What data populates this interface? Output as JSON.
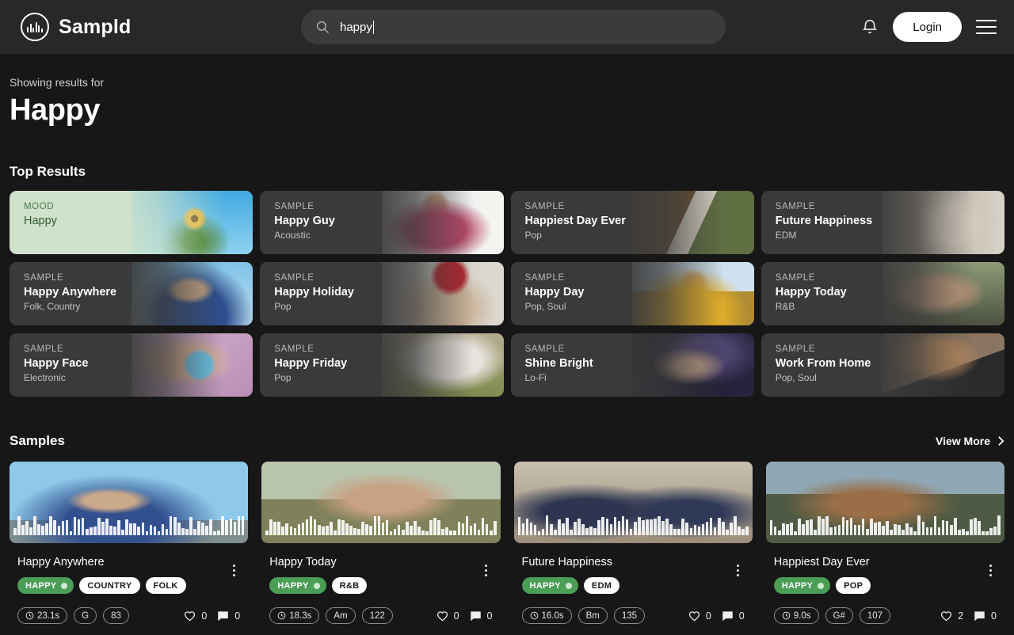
{
  "header": {
    "brand": "Sampld",
    "brand_logo_icon": "waveform-circle-icon",
    "search": {
      "icon": "search-icon",
      "value": "happy",
      "placeholder": "Search"
    },
    "notifications_icon": "bell-icon",
    "login_label": "Login",
    "menu_icon": "hamburger-menu-icon"
  },
  "results": {
    "showing_label": "Showing results for",
    "query": "Happy"
  },
  "top_results": {
    "title": "Top Results",
    "cards": [
      {
        "kind": "MOOD",
        "title": "Happy",
        "sub": "",
        "art": "ph-sunflower",
        "highlight": true
      },
      {
        "kind": "SAMPLE",
        "title": "Happy Guy",
        "sub": "Acoustic",
        "art": "ph-man-pink",
        "highlight": false
      },
      {
        "kind": "SAMPLE",
        "title": "Happiest Day Ever",
        "sub": "Pop",
        "art": "ph-road",
        "highlight": false
      },
      {
        "kind": "SAMPLE",
        "title": "Future Happiness",
        "sub": "EDM",
        "art": "ph-office",
        "highlight": false
      },
      {
        "kind": "SAMPLE",
        "title": "Happy Anywhere",
        "sub": "Folk, Country",
        "art": "ph-bluesky-girl",
        "highlight": false
      },
      {
        "kind": "SAMPLE",
        "title": "Happy Holiday",
        "sub": "Pop",
        "art": "ph-redcap",
        "highlight": false
      },
      {
        "kind": "SAMPLE",
        "title": "Happy Day",
        "sub": "Pop, Soul",
        "art": "ph-sunfield",
        "highlight": false
      },
      {
        "kind": "SAMPLE",
        "title": "Happy Today",
        "sub": "R&B",
        "art": "ph-beard",
        "highlight": false
      },
      {
        "kind": "SAMPLE",
        "title": "Happy Face",
        "sub": "Electronic",
        "art": "ph-girl-egg",
        "highlight": false
      },
      {
        "kind": "SAMPLE",
        "title": "Happy Friday",
        "sub": "Pop",
        "art": "ph-smile-rock",
        "highlight": false
      },
      {
        "kind": "SAMPLE",
        "title": "Shine Bright",
        "sub": "Lo-Fi",
        "art": "ph-galaxy",
        "highlight": false
      },
      {
        "kind": "SAMPLE",
        "title": "Work From Home",
        "sub": "Pop, Soul",
        "art": "ph-guitar",
        "highlight": false
      }
    ]
  },
  "samples": {
    "title": "Samples",
    "view_more_label": "View More",
    "view_more_icon": "chevron-right-icon",
    "cards": [
      {
        "title": "Happy Anywhere",
        "art": "ph-beach-girl",
        "mood_tag": "HAPPY",
        "tags": [
          "COUNTRY",
          "FOLK"
        ],
        "duration": "23.1s",
        "key": "G",
        "bpm": "83",
        "likes": "0",
        "comments": "0"
      },
      {
        "title": "Happy Today",
        "art": "ph-couple-field",
        "mood_tag": "HAPPY",
        "tags": [
          "R&B"
        ],
        "duration": "18.3s",
        "key": "Am",
        "bpm": "122",
        "likes": "0",
        "comments": "0"
      },
      {
        "title": "Future Happiness",
        "art": "ph-highfive",
        "mood_tag": "HAPPY",
        "tags": [
          "EDM"
        ],
        "duration": "16.0s",
        "key": "Bm",
        "bpm": "135",
        "likes": "0",
        "comments": "0"
      },
      {
        "title": "Happiest Day Ever",
        "art": "ph-car-window",
        "mood_tag": "HAPPY",
        "tags": [
          "POP"
        ],
        "duration": "9.0s",
        "key": "G#",
        "bpm": "107",
        "likes": "2",
        "comments": "0"
      }
    ]
  },
  "colors": {
    "page_bg": "#171717",
    "header_bg": "#282828",
    "card_bg": "#3a3a3a",
    "mood_card_bg": "#cfe2cb",
    "mood_card_text": "#2e5c33",
    "mood_tag_green": "#4a9e56",
    "accent_white": "#ffffff"
  }
}
